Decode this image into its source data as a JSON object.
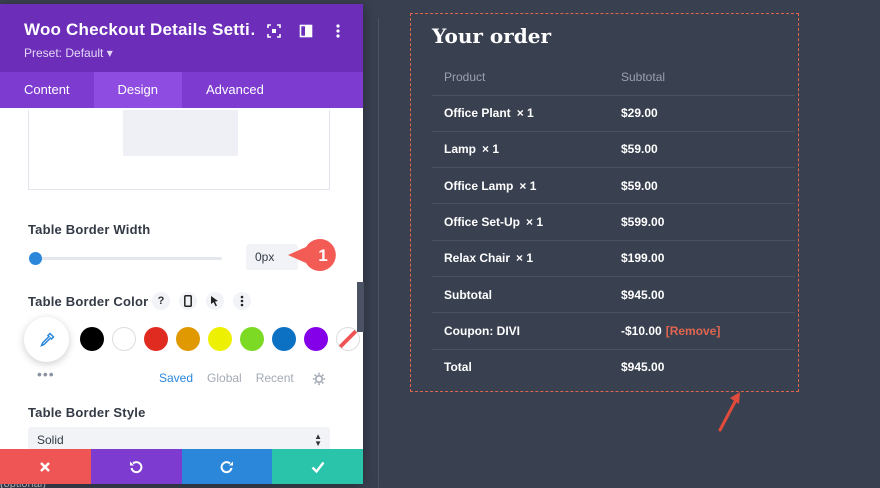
{
  "panel": {
    "title": "Woo Checkout Details Setti…",
    "preset": "Preset: Default ▾",
    "tabs": [
      "Content",
      "Design",
      "Advanced"
    ],
    "active_tab": "Design"
  },
  "border_width": {
    "label": "Table Border Width",
    "value": "0px",
    "slider_fraction": 0.0
  },
  "callout": {
    "number": "1",
    "color": "#f25c54"
  },
  "border_color": {
    "label": "Table Border Color",
    "icons": [
      "help-icon",
      "mobile-icon",
      "hover-cursor-icon",
      "more-vertical-icon"
    ],
    "swatches": [
      "#000000",
      "#ffffff",
      "#e02b20",
      "#e09900",
      "#edf000",
      "#7cda24",
      "#0c71c3",
      "#8300e9",
      "none"
    ],
    "color_tabs": [
      "Saved",
      "Global",
      "Recent"
    ],
    "active_color_tab": "Saved"
  },
  "border_style": {
    "label": "Table Border Style",
    "value": "Solid"
  },
  "footer": {
    "buttons": [
      "close-icon",
      "undo-icon",
      "redo-icon",
      "check-icon"
    ],
    "colors": [
      "#ef5555",
      "#7e3bd0",
      "#2b87da",
      "#29c4a9"
    ]
  },
  "background_text": "(optional)",
  "order": {
    "title": "Your order",
    "headers": [
      "Product",
      "Subtotal"
    ],
    "rows": [
      {
        "product": "Office Plant",
        "qty": "× 1",
        "subtotal": "$29.00"
      },
      {
        "product": "Lamp",
        "qty": "× 1",
        "subtotal": "$59.00"
      },
      {
        "product": "Office Lamp",
        "qty": "× 1",
        "subtotal": "$59.00"
      },
      {
        "product": "Office Set-Up",
        "qty": "× 1",
        "subtotal": "$599.00"
      },
      {
        "product": "Relax Chair",
        "qty": "× 1",
        "subtotal": "$199.00"
      }
    ],
    "subtotal_label": "Subtotal",
    "subtotal_value": "$945.00",
    "coupon_label": "Coupon: DIVI",
    "coupon_value": "-$10.00",
    "coupon_remove": "[Remove]",
    "total_label": "Total",
    "total_value": "$945.00",
    "accent": "#e0654f"
  }
}
